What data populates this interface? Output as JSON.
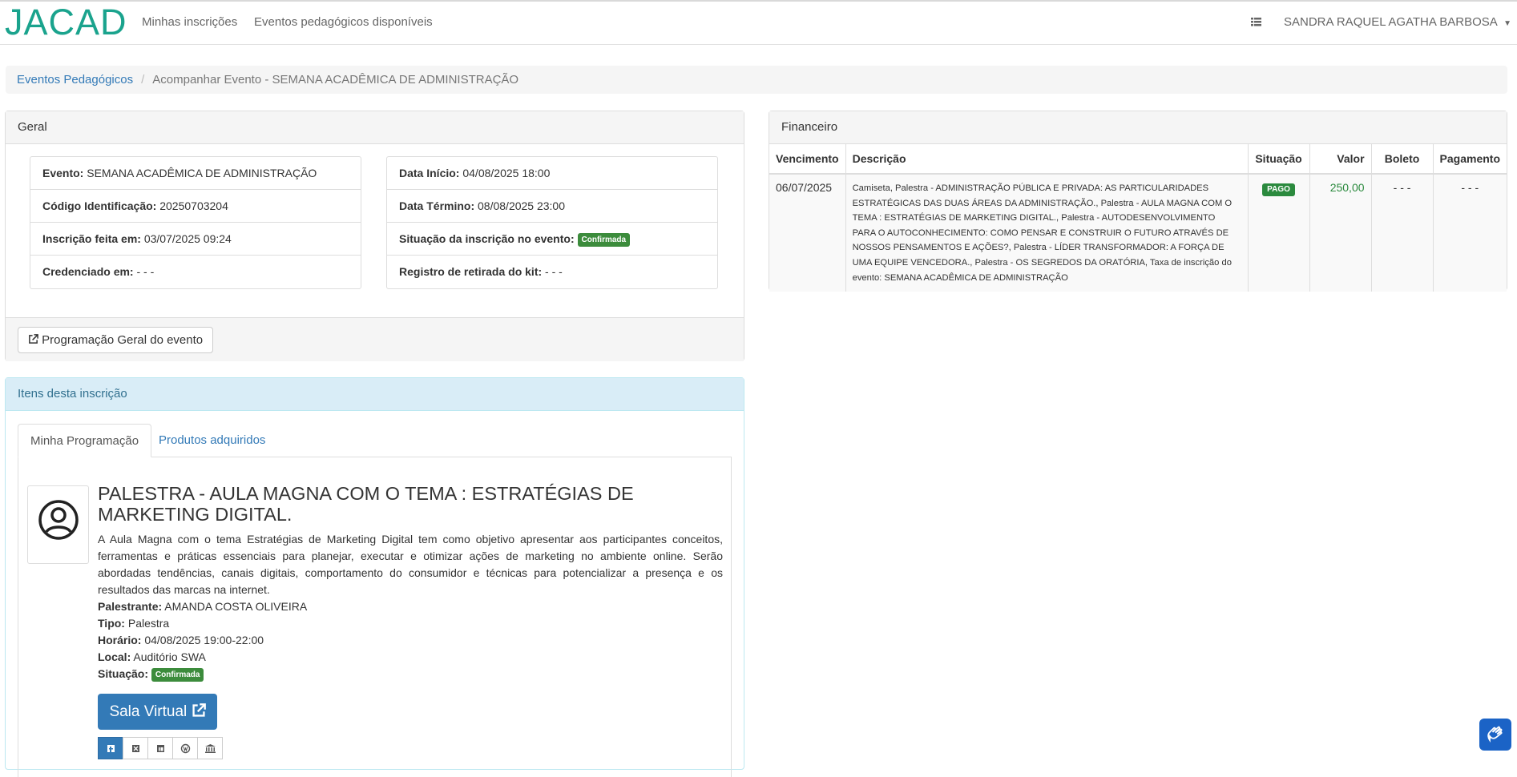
{
  "navbar": {
    "logo": "JACAD",
    "links": [
      "Minhas inscrições",
      "Eventos pedagógicos disponíveis"
    ],
    "menu_icon": "list-icon",
    "user": "SANDRA RAQUEL AGATHA BARBOSA"
  },
  "breadcrumb": {
    "link": "Eventos Pedagógicos",
    "active": "Acompanhar Evento - SEMANA ACADÊMICA DE ADMINISTRAÇÃO"
  },
  "geral": {
    "heading": "Geral",
    "left": [
      {
        "label": "Evento:",
        "value": "SEMANA ACADÊMICA DE ADMINISTRAÇÃO"
      },
      {
        "label": "Código Identificação:",
        "value": "20250703204"
      },
      {
        "label": "Inscrição feita em:",
        "value": "03/07/2025 09:24"
      },
      {
        "label": "Credenciado em:",
        "value": "- - -"
      }
    ],
    "right": [
      {
        "label": "Data Início:",
        "value": "04/08/2025 18:00"
      },
      {
        "label": "Data Término:",
        "value": "08/08/2025 23:00"
      },
      {
        "label": "Situação da inscrição no evento:",
        "badge": "Confirmada"
      },
      {
        "label": "Registro de retirada do kit:",
        "value": "- - -"
      }
    ],
    "button": "Programação Geral do evento"
  },
  "itens": {
    "heading": "Itens desta inscrição",
    "tabs": [
      "Minha Programação",
      "Produtos adquiridos"
    ],
    "palestra": {
      "title": "PALESTRA - AULA MAGNA COM O TEMA : ESTRATÉGIAS DE MARKETING DIGITAL.",
      "description": "A Aula Magna com o tema Estratégias de Marketing Digital tem como objetivo apresentar aos participantes conceitos, ferramentas e práticas essenciais para planejar, executar e otimizar ações de marketing no ambiente online. Serão abordadas tendências, canais digitais, comportamento do consumidor e técnicas para potencializar a presença e os resultados das marcas na internet.",
      "palestrante_label": "Palestrante:",
      "palestrante": "AMANDA COSTA OLIVEIRA",
      "tipo_label": "Tipo:",
      "tipo": "Palestra",
      "horario_label": "Horário:",
      "horario": "04/08/2025 19:00-22:00",
      "local_label": "Local:",
      "local": "Auditório SWA",
      "situacao_label": "Situação:",
      "situacao": "Confirmada",
      "sala_button": "Sala Virtual",
      "share_icons": [
        "facebook-icon",
        "x-twitter-icon",
        "linkedin-icon",
        "wordpress-icon",
        "institution-icon"
      ]
    }
  },
  "financeiro": {
    "heading": "Financeiro",
    "columns": [
      "Vencimento",
      "Descrição",
      "Situação",
      "Valor",
      "Boleto",
      "Pagamento"
    ],
    "rows": [
      {
        "vencimento": "06/07/2025",
        "descricao": "Camiseta, Palestra - ADMINISTRAÇÃO PÚBLICA E PRIVADA: AS PARTICULARIDADES ESTRATÉGICAS DAS DUAS ÁREAS DA ADMINISTRAÇÃO., Palestra - AULA MAGNA COM O TEMA : ESTRATÉGIAS DE MARKETING DIGITAL., Palestra - AUTODESENVOLVIMENTO PARA O AUTOCONHECIMENTO: COMO PENSAR E CONSTRUIR O FUTURO ATRAVÉS DE NOSSOS PENSAMENTOS E AÇÕES?, Palestra - LÍDER TRANSFORMADOR: A FORÇA DE UMA EQUIPE VENCEDORA., Palestra - OS SEGREDOS DA ORATÓRIA, Taxa de inscrição do evento: SEMANA ACADÊMICA DE ADMINISTRAÇÃO",
        "situacao": "PAGO",
        "valor": "250,00",
        "boleto": "- - -",
        "pagamento": "- - -"
      }
    ]
  },
  "colors": {
    "logo": "#1aa38d",
    "link": "#337ab7",
    "badge_green": "#3c8c3c",
    "valor_green": "#2b8a3e",
    "info_heading_bg": "#d9edf7"
  },
  "accessibility_icon": "hand-sign-icon"
}
